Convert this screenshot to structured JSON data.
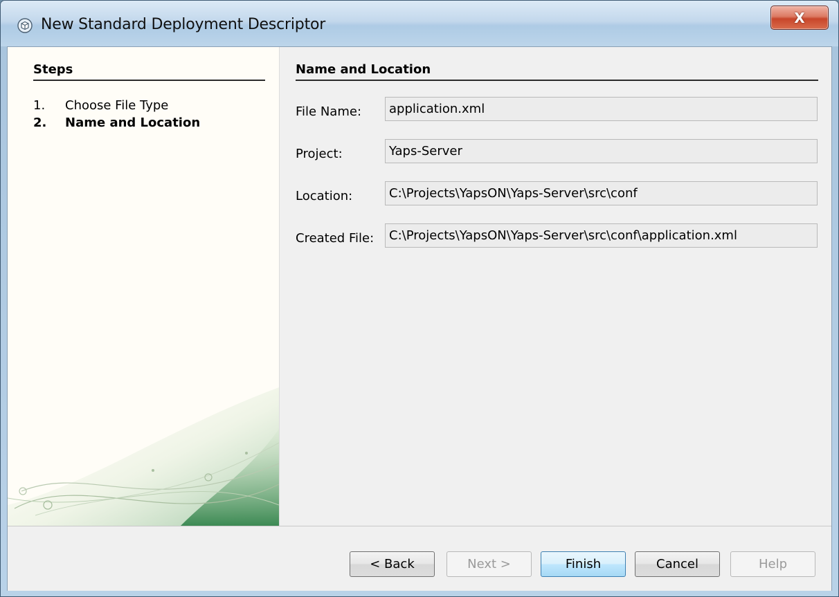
{
  "window": {
    "title": "New Standard Deployment Descriptor",
    "close_label": "X"
  },
  "steps": {
    "heading": "Steps",
    "items": [
      {
        "number": "1.",
        "label": "Choose File Type"
      },
      {
        "number": "2.",
        "label": "Name and Location"
      }
    ]
  },
  "main": {
    "heading": "Name and Location",
    "fields": [
      {
        "label": "File Name:",
        "value": "application.xml"
      },
      {
        "label": "Project:",
        "value": "Yaps-Server"
      },
      {
        "label": "Location:",
        "value": "C:\\Projects\\YapsON\\Yaps-Server\\src\\conf"
      },
      {
        "label": "Created File:",
        "value": "C:\\Projects\\YapsON\\Yaps-Server\\src\\conf\\application.xml"
      }
    ]
  },
  "buttons": {
    "back": "< Back",
    "next": "Next >",
    "finish": "Finish",
    "cancel": "Cancel",
    "help": "Help"
  },
  "icons": {
    "title": "cube-icon",
    "close": "close-icon"
  }
}
